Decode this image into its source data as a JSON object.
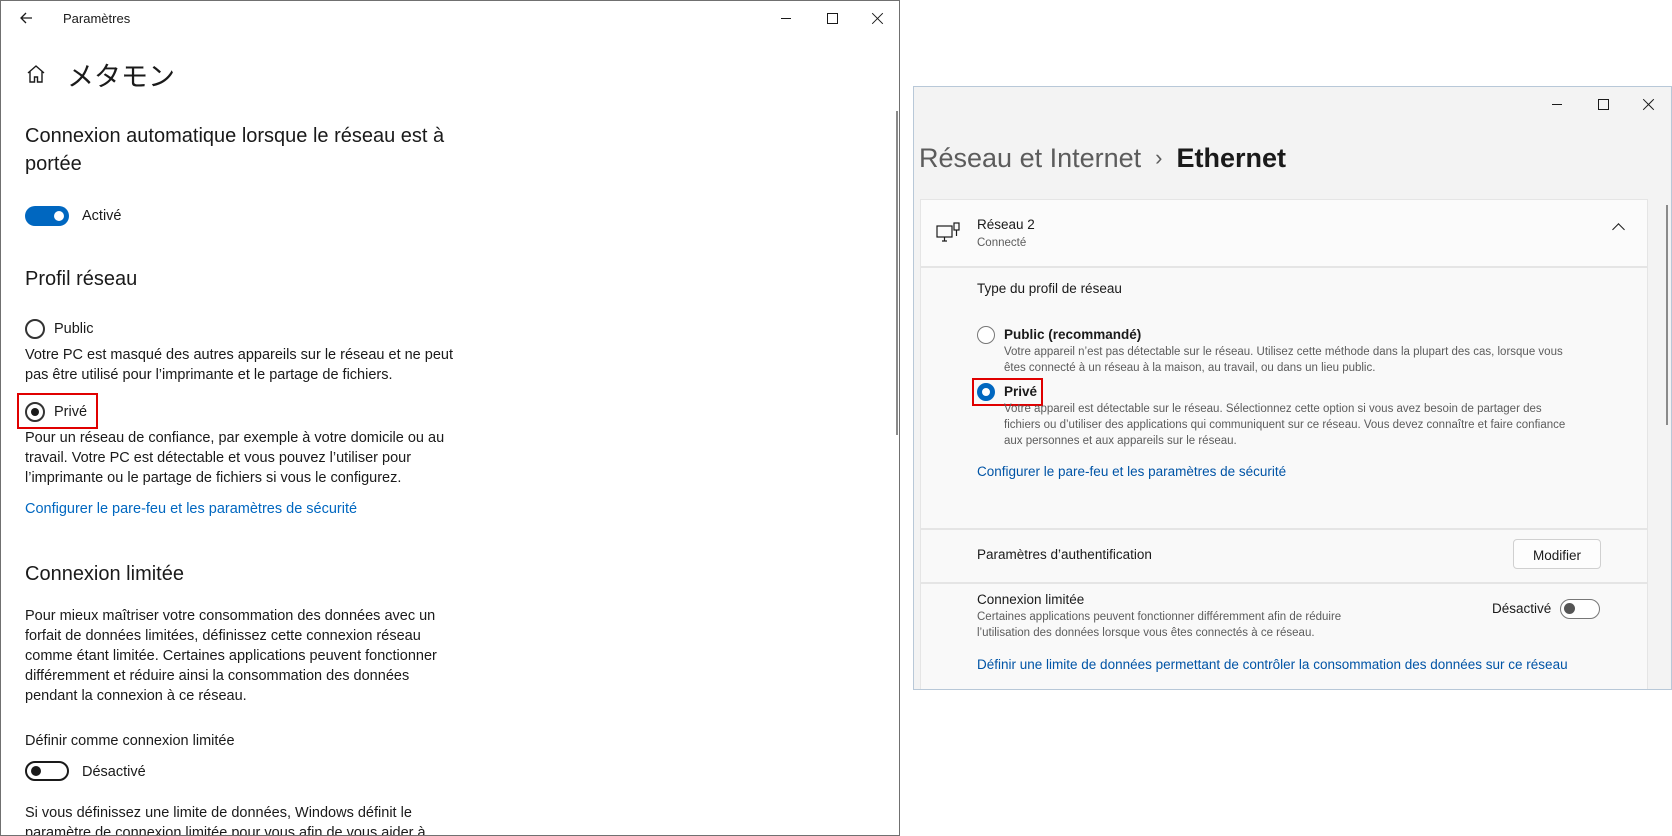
{
  "left": {
    "app_title": "Paramètres",
    "page_title": "メタモン",
    "auto_connect": {
      "heading": "Connexion automatique lorsque le réseau est à portée",
      "toggle_label": "Activé",
      "toggle_on": true
    },
    "profile": {
      "heading": "Profil réseau",
      "public_label": "Public",
      "public_desc": "Votre PC est masqué des autres appareils sur le réseau et ne peut pas être utilisé pour l’imprimante et le partage de fichiers.",
      "private_label": "Privé",
      "private_desc": "Pour un réseau de confiance, par exemple à votre domicile ou au travail. Votre PC est détectable et vous pouvez l’utiliser pour l’imprimante ou le partage de fichiers si vous le configurez.",
      "selected": "Privé",
      "firewall_link": "Configurer le pare-feu et les paramètres de sécurité"
    },
    "metered": {
      "heading": "Connexion limitée",
      "desc": "Pour mieux maîtriser votre consommation des données avec un forfait de données limitées, définissez cette connexion réseau comme étant limitée. Certaines applications peuvent fonctionner différemment et réduire ainsi la consommation des données pendant la connexion à ce réseau.",
      "set_label": "Définir comme connexion limitée",
      "toggle_label": "Désactivé",
      "toggle_on": false,
      "footer": "Si vous définissez une limite de données, Windows définit le paramètre de connexion limitée pour vous afin de vous aider à"
    }
  },
  "right": {
    "breadcrumb": {
      "parent": "Réseau et Internet",
      "separator": "›",
      "current": "Ethernet"
    },
    "network": {
      "name": "Réseau 2",
      "status": "Connecté"
    },
    "profile": {
      "heading": "Type du profil de réseau",
      "public_label": "Public (recommandé)",
      "public_desc": "Votre appareil n’est pas détectable sur le réseau. Utilisez cette méthode dans la plupart des cas, lorsque vous êtes connecté à un réseau à la maison, au travail, ou dans un lieu public.",
      "private_label": "Privé",
      "private_desc": "Votre appareil est détectable sur le réseau. Sélectionnez cette option si vous avez besoin de partager des fichiers ou d’utiliser des applications qui communiquent sur ce réseau. Vous devez connaître et faire confiance aux personnes et aux appareils sur le réseau.",
      "selected": "Privé",
      "firewall_link": "Configurer le pare-feu et les paramètres de sécurité"
    },
    "auth": {
      "label": "Paramètres d’authentification",
      "button": "Modifier"
    },
    "metered": {
      "title": "Connexion limitée",
      "desc": "Certaines applications peuvent fonctionner différemment afin de réduire l’utilisation des données lorsque vous êtes connectés à ce réseau.",
      "toggle_label": "Désactivé",
      "toggle_on": false,
      "data_limit_link": "Définir une limite de données permettant de contrôler la consommation des données sur ce réseau"
    }
  },
  "colors": {
    "accent": "#0067c0",
    "link": "#0067c0",
    "highlight": "#e00000"
  }
}
